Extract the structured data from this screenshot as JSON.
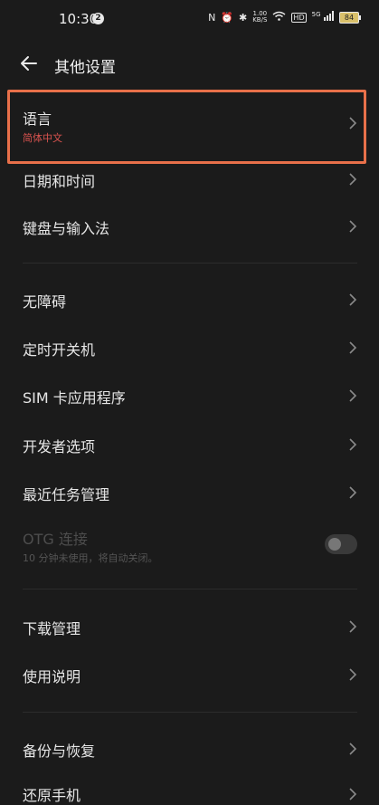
{
  "status": {
    "time": "10:30",
    "notification_count": "2",
    "net_speed_top": "1.00",
    "net_speed_bottom": "KB/S",
    "hd": "HD",
    "signal": "5G",
    "battery": "84"
  },
  "header": {
    "title": "其他设置"
  },
  "items": [
    {
      "label": "语言",
      "sub": "简体中文"
    },
    {
      "label": "日期和时间"
    },
    {
      "label": "键盘与输入法"
    },
    {
      "label": "无障碍"
    },
    {
      "label": "定时开关机"
    },
    {
      "label": "SIM 卡应用程序"
    },
    {
      "label": "开发者选项"
    },
    {
      "label": "最近任务管理"
    },
    {
      "label": "OTG 连接",
      "sub": "10 分钟未使用，将自动关闭。"
    },
    {
      "label": "下载管理"
    },
    {
      "label": "使用说明"
    },
    {
      "label": "备份与恢复"
    },
    {
      "label": "还原手机"
    }
  ],
  "colors": {
    "accent_sub": "#d9534f",
    "highlight": "#e8704a"
  }
}
